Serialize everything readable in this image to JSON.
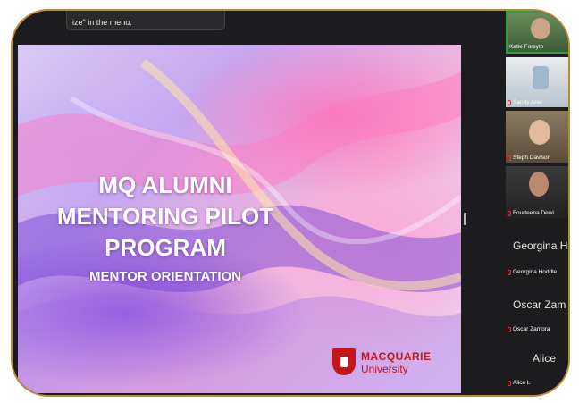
{
  "tooltip": {
    "text": "ize\" in the menu."
  },
  "slide": {
    "title_line1": "MQ ALUMNI",
    "title_line2": "MENTORING PILOT",
    "title_line3": "PROGRAM",
    "subtitle": "MENTOR ORIENTATION",
    "logo_line1": "MACQUARIE",
    "logo_line2": "University"
  },
  "participants": [
    {
      "name": "Katie Forsyth",
      "video": true,
      "active": true
    },
    {
      "name": "Sandy Ariel",
      "video": true,
      "muted": true
    },
    {
      "name": "Steph Davison",
      "video": true,
      "muted": true
    },
    {
      "name": "Fourteena Dewi",
      "video": true,
      "muted": true
    },
    {
      "name": "Georgina Hoddle",
      "display": "Georgina Ho",
      "video": false,
      "muted": true
    },
    {
      "name": "Oscar Zamora",
      "display": "Oscar Zam",
      "video": false,
      "muted": true
    },
    {
      "name": "Alice L",
      "display": "Alice",
      "video": false,
      "muted": true
    }
  ],
  "colors": {
    "frame_border": "#b8893c",
    "app_bg": "#1c1c1e",
    "brand_red": "#c2161b",
    "active_speaker": "#2ea043"
  }
}
